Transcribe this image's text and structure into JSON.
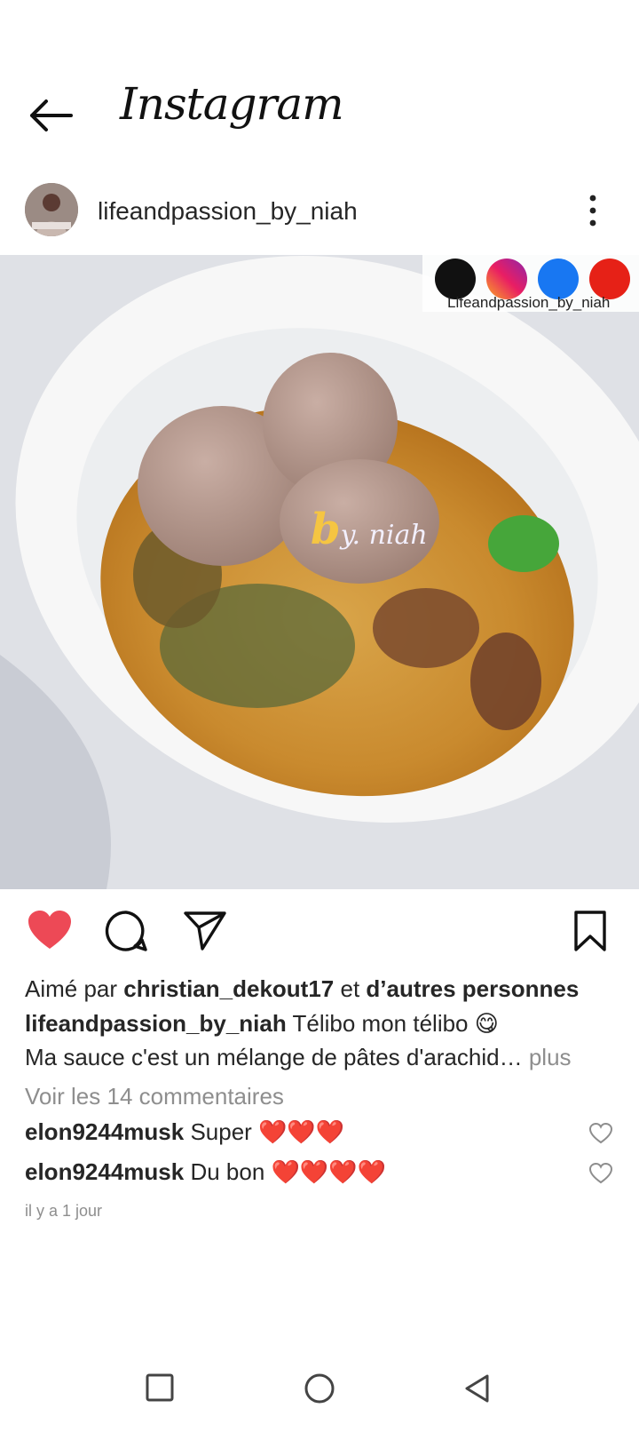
{
  "header": {
    "title": "Instagram"
  },
  "post": {
    "username": "lifeandpassion_by_niah",
    "photo": {
      "social_handle": "Lifeandpassion_by_niah",
      "watermark_by": "b",
      "watermark_text": "y. niah"
    },
    "likes": {
      "prefix": "Aimé par",
      "user": "christian_dekout17",
      "connector": "et",
      "others": "d’autres personnes"
    },
    "caption": {
      "user": "lifeandpassion_by_niah",
      "text": "Télibo mon télibo 😋",
      "line2": "Ma sauce c'est un mélange de pâtes d'arachid…",
      "more": "plus"
    },
    "view_comments": "Voir les 14 commentaires",
    "comments": [
      {
        "user": "elon9244musk",
        "text": "Super ❤️❤️❤️"
      },
      {
        "user": "elon9244musk",
        "text": "Du bon ❤️❤️❤️❤️"
      }
    ],
    "timestamp": "il y a 1 jour"
  },
  "colors": {
    "like": "#ed4956",
    "muted": "#8e8e8e",
    "text": "#262626"
  }
}
